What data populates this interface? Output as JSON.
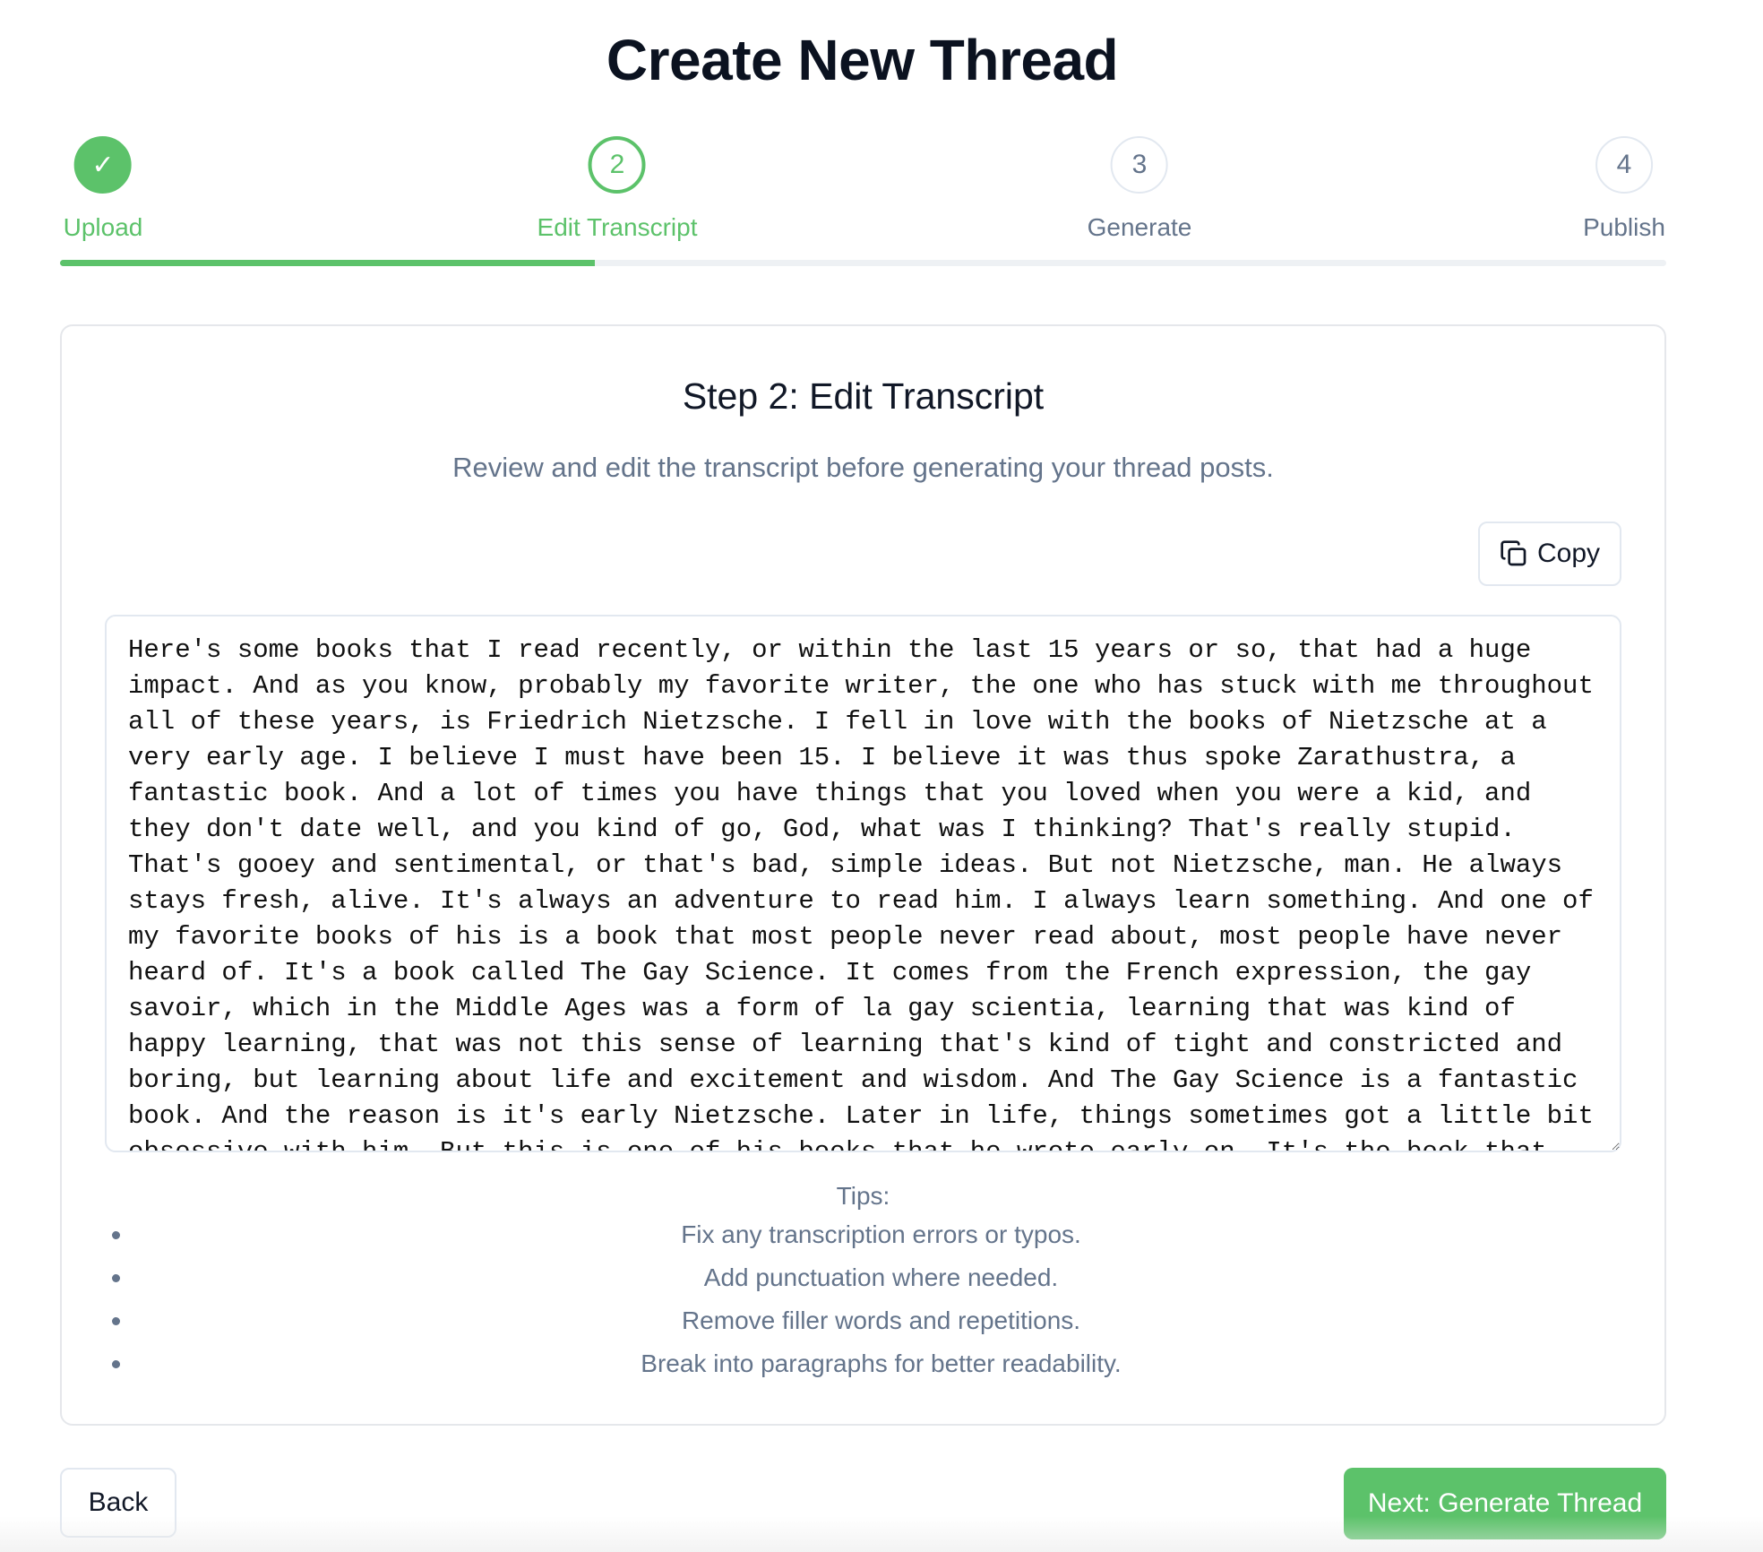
{
  "page": {
    "title": "Create New Thread"
  },
  "stepper": {
    "progress": 0.333,
    "steps": [
      {
        "label": "Upload",
        "number": "1",
        "state": "completed",
        "icon": "check-icon"
      },
      {
        "label": "Edit Transcript",
        "number": "2",
        "state": "active"
      },
      {
        "label": "Generate",
        "number": "3",
        "state": "upcoming"
      },
      {
        "label": "Publish",
        "number": "4",
        "state": "upcoming"
      }
    ]
  },
  "card": {
    "title": "Step 2: Edit Transcript",
    "subtitle": "Review and edit the transcript before generating your thread posts.",
    "copy_label": "Copy",
    "copy_icon": "copy-icon",
    "transcript": "Here's some books that I read recently, or within the last 15 years or so, that had a huge impact. And as you know, probably my favorite writer, the one who has stuck with me throughout all of these years, is Friedrich Nietzsche. I fell in love with the books of Nietzsche at a very early age. I believe I must have been 15. I believe it was thus spoke Zarathustra, a fantastic book. And a lot of times you have things that you loved when you were a kid, and they don't date well, and you kind of go, God, what was I thinking? That's really stupid. That's gooey and sentimental, or that's bad, simple ideas. But not Nietzsche, man. He always stays fresh, alive. It's always an adventure to read him. I always learn something. And one of my favorite books of his is a book that most people never read about, most people have never heard of. It's a book called The Gay Science. It comes from the French expression, the gay savoir, which in the Middle Ages was a form of la gay scientia, learning that was kind of happy learning, that was not this sense of learning that's kind of tight and constricted and boring, but learning about life and excitement and wisdom. And The Gay Science is a fantastic book. And the reason is it's early Nietzsche. Later in life, things sometimes got a little bit obsessive with him. But this is one of his books that he wrote early on. It's the book that",
    "tips_title": "Tips:",
    "tips": [
      "Fix any transcription errors or typos.",
      "Add punctuation where needed.",
      "Remove filler words and repetitions.",
      "Break into paragraphs for better readability."
    ]
  },
  "footer": {
    "back_label": "Back",
    "next_label": "Next: Generate Thread"
  },
  "colors": {
    "accent": "#5cc26a",
    "muted_text": "#64748b",
    "border": "#e2e8f0"
  }
}
